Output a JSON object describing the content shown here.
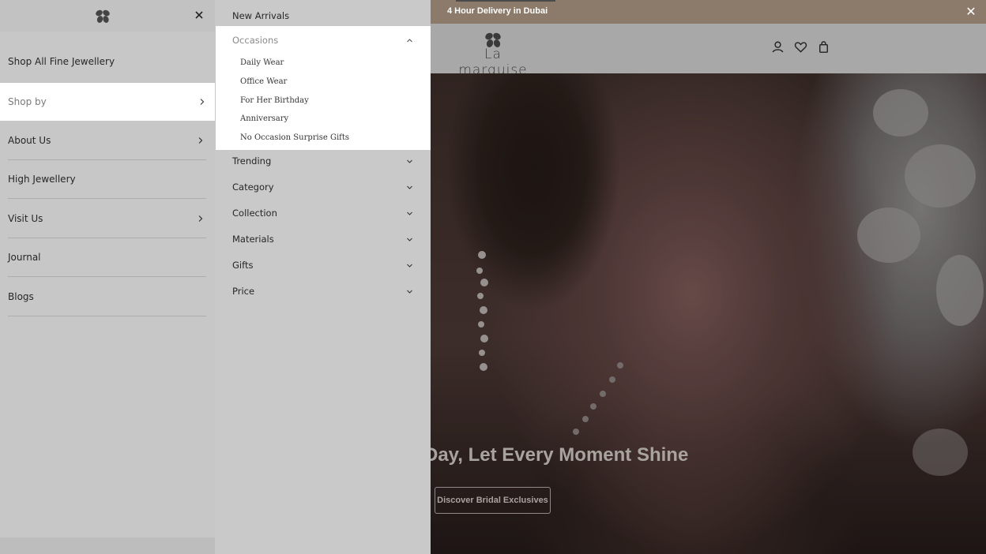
{
  "announcement": {
    "text": "4 Hour Delivery in Dubai"
  },
  "brand": {
    "name": "La marquise"
  },
  "hero": {
    "title": "Day, Let Every Moment Shine",
    "button_label": "Discover Bridal Exclusives"
  },
  "menu_level1": {
    "items": [
      {
        "label": "Shop All Fine Jewellery",
        "has_children": false
      },
      {
        "label": "Shop by",
        "has_children": true,
        "active": true
      },
      {
        "label": "About Us",
        "has_children": true
      },
      {
        "label": "High Jewellery",
        "has_children": false
      },
      {
        "label": "Visit Us",
        "has_children": true
      },
      {
        "label": "Journal",
        "has_children": false
      },
      {
        "label": "Blogs",
        "has_children": false
      }
    ]
  },
  "menu_level2": {
    "top_link": "New Arrivals",
    "expanded": {
      "label": "Occasions",
      "children": [
        "Daily Wear",
        "Office Wear",
        "For Her Birthday",
        "Anniversary",
        "No Occasion Surprise Gifts"
      ]
    },
    "groups": [
      "Trending",
      "Category",
      "Collection",
      "Materials",
      "Gifts",
      "Price"
    ]
  },
  "icons": {
    "announcement_close": "close-icon",
    "drawer_close": "close-icon",
    "logo": "clover-logo-icon",
    "account": "user-icon",
    "wishlist": "heart-icon",
    "cart": "bag-icon"
  },
  "colors": {
    "announcement_bg": "#8c7a6a",
    "overlay_grey": "#c7c7c7",
    "active_item_bg": "#ffffff"
  }
}
